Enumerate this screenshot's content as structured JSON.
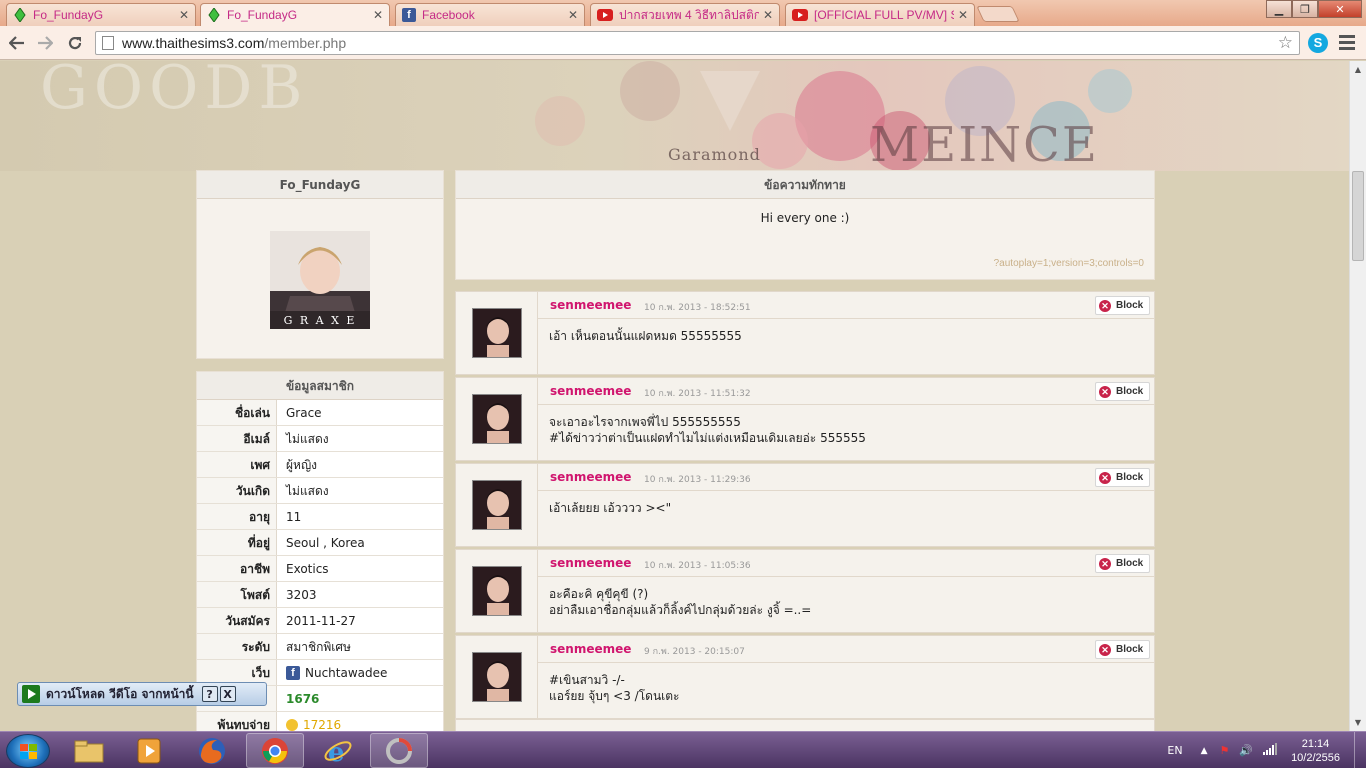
{
  "browser": {
    "tabs": [
      {
        "title": "Fo_FundayG",
        "icon": "sims-icon",
        "active": false
      },
      {
        "title": "Fo_FundayG",
        "icon": "sims-icon",
        "active": true
      },
      {
        "title": "Facebook",
        "icon": "facebook-icon",
        "active": false
      },
      {
        "title": "ปากสวยเทพ 4 วิธีทาลิปสติก - ",
        "icon": "youtube-icon",
        "active": false
      },
      {
        "title": "[OFFICIAL FULL PV/MV] Su",
        "icon": "youtube-icon",
        "active": false
      }
    ],
    "url_host": "www.thaithesims3.com",
    "url_path": "/member.php"
  },
  "banner": {
    "watermark_main": "GOODB",
    "watermark_script": "Garamond"
  },
  "profile": {
    "name": "Fo_FundayG",
    "avatar_caption": "G R A X E"
  },
  "member_info": {
    "title": "ข้อมูลสมาชิก",
    "rows": [
      {
        "key": "ชื่อเล่น",
        "value": "Grace"
      },
      {
        "key": "อีเมล์",
        "value": "ไม่แสดง"
      },
      {
        "key": "เพศ",
        "value": "ผู้หญิง"
      },
      {
        "key": "วันเกิด",
        "value": "ไม่แสดง"
      },
      {
        "key": "อายุ",
        "value": "11"
      },
      {
        "key": "ที่อยู่",
        "value": "Seoul , Korea"
      },
      {
        "key": "อาชีพ",
        "value": "Exotics"
      },
      {
        "key": "โพสต์",
        "value": "3203"
      },
      {
        "key": "วันสมัคร",
        "value": "2011-11-27"
      },
      {
        "key": "ระดับ",
        "value": "สมาชิกพิเศษ"
      },
      {
        "key": "เว็บ",
        "value": "Nuchtawadee"
      },
      {
        "key": "",
        "value": "1676"
      },
      {
        "key": "พ้นทบจ่าย",
        "value": "17216"
      }
    ]
  },
  "greeting": {
    "title": "ข้อความทักทาย",
    "text": "Hi every one :)",
    "params": "?autoplay=1;version=3;controls=0"
  },
  "comments": [
    {
      "user": "senmeemee",
      "time": "10 ก.พ. 2013 - 18:52:51",
      "lines": [
        "เอ้า เห็นตอนนั้นแฝดหมด 55555555"
      ]
    },
    {
      "user": "senmeemee",
      "time": "10 ก.พ. 2013 - 11:51:32",
      "lines": [
        "จะเอาอะไรจากเพจพี่ไป 555555555",
        "#ได้ข่าวว่าต่าเป็นแฝดทำไมไม่แต่งเหมือนเดิมเลยอ่ะ 555555"
      ]
    },
    {
      "user": "senmeemee",
      "time": "10 ก.พ. 2013 - 11:29:36",
      "lines": [
        "เอ้าเล้ยยย เอ้วววว ><\""
      ]
    },
    {
      "user": "senmeemee",
      "time": "10 ก.พ. 2013 - 11:05:36",
      "lines": [
        "อะคือะคิ คุขีคุขี (?)",
        "อย่าลืมเอาชื่อกลุ่มแล้วก็ลิ้งค์ไปกลุ่มด้วยล่ะ งูจิ้ =..="
      ]
    },
    {
      "user": "senmeemee",
      "time": "9 ก.พ. 2013 - 20:15:07",
      "lines": [
        "#เขินสามวิ -/-",
        "แอร์ยย จุ้บๆ <3 /โดนเตะ"
      ]
    }
  ],
  "block_label": "Block",
  "download_bar": {
    "label": "ดาวน์โหลด วีดีโอ จากหน้านี้",
    "help": "?",
    "close": "X"
  },
  "taskbar": {
    "lang": "EN",
    "time": "21:14",
    "date": "10/2/2556"
  }
}
